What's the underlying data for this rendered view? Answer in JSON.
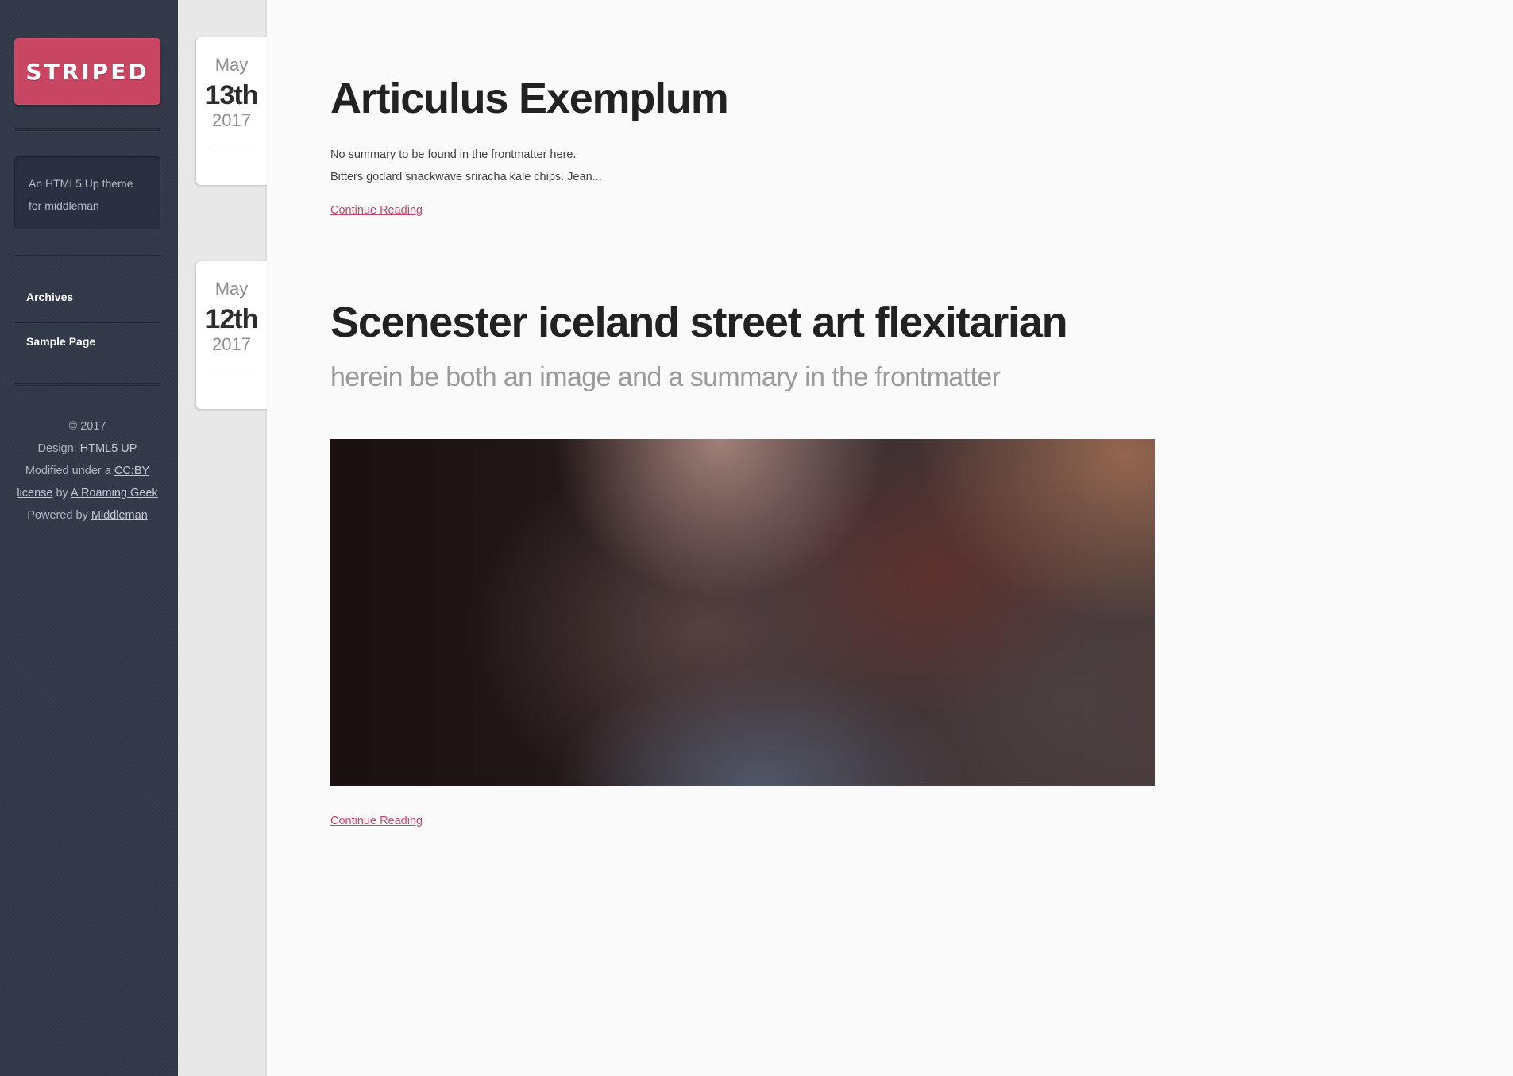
{
  "site": {
    "logo": "STRIPED",
    "tagline": "An HTML5 Up theme for middleman"
  },
  "nav": {
    "items": [
      {
        "label": "Archives"
      },
      {
        "label": "Sample Page"
      }
    ]
  },
  "footer": {
    "copyright": "© 2017",
    "design_prefix": "Design: ",
    "design_link": "HTML5 UP",
    "modified_prefix": "Modified under a ",
    "license_link": "CC:BY license",
    "by_text": " by ",
    "author_link": "A Roaming Geek",
    "powered_prefix": "Powered by ",
    "powered_link": "Middleman"
  },
  "posts": [
    {
      "month": "May",
      "day": "13th",
      "year": "2017",
      "title": "Articulus Exemplum",
      "summary_line1": "No summary to be found in the frontmatter here.",
      "summary_line2": "Bitters godard snackwave sriracha kale chips. Jean...",
      "read_more": "Continue Reading"
    },
    {
      "month": "May",
      "day": "12th",
      "year": "2017",
      "title": "Scenester iceland street art flexitarian",
      "subtitle": "herein be both an image and a summary in the frontmatter",
      "read_more": "Continue Reading"
    }
  ],
  "colors": {
    "accent": "#c94663",
    "sidebar": "#323a49"
  }
}
